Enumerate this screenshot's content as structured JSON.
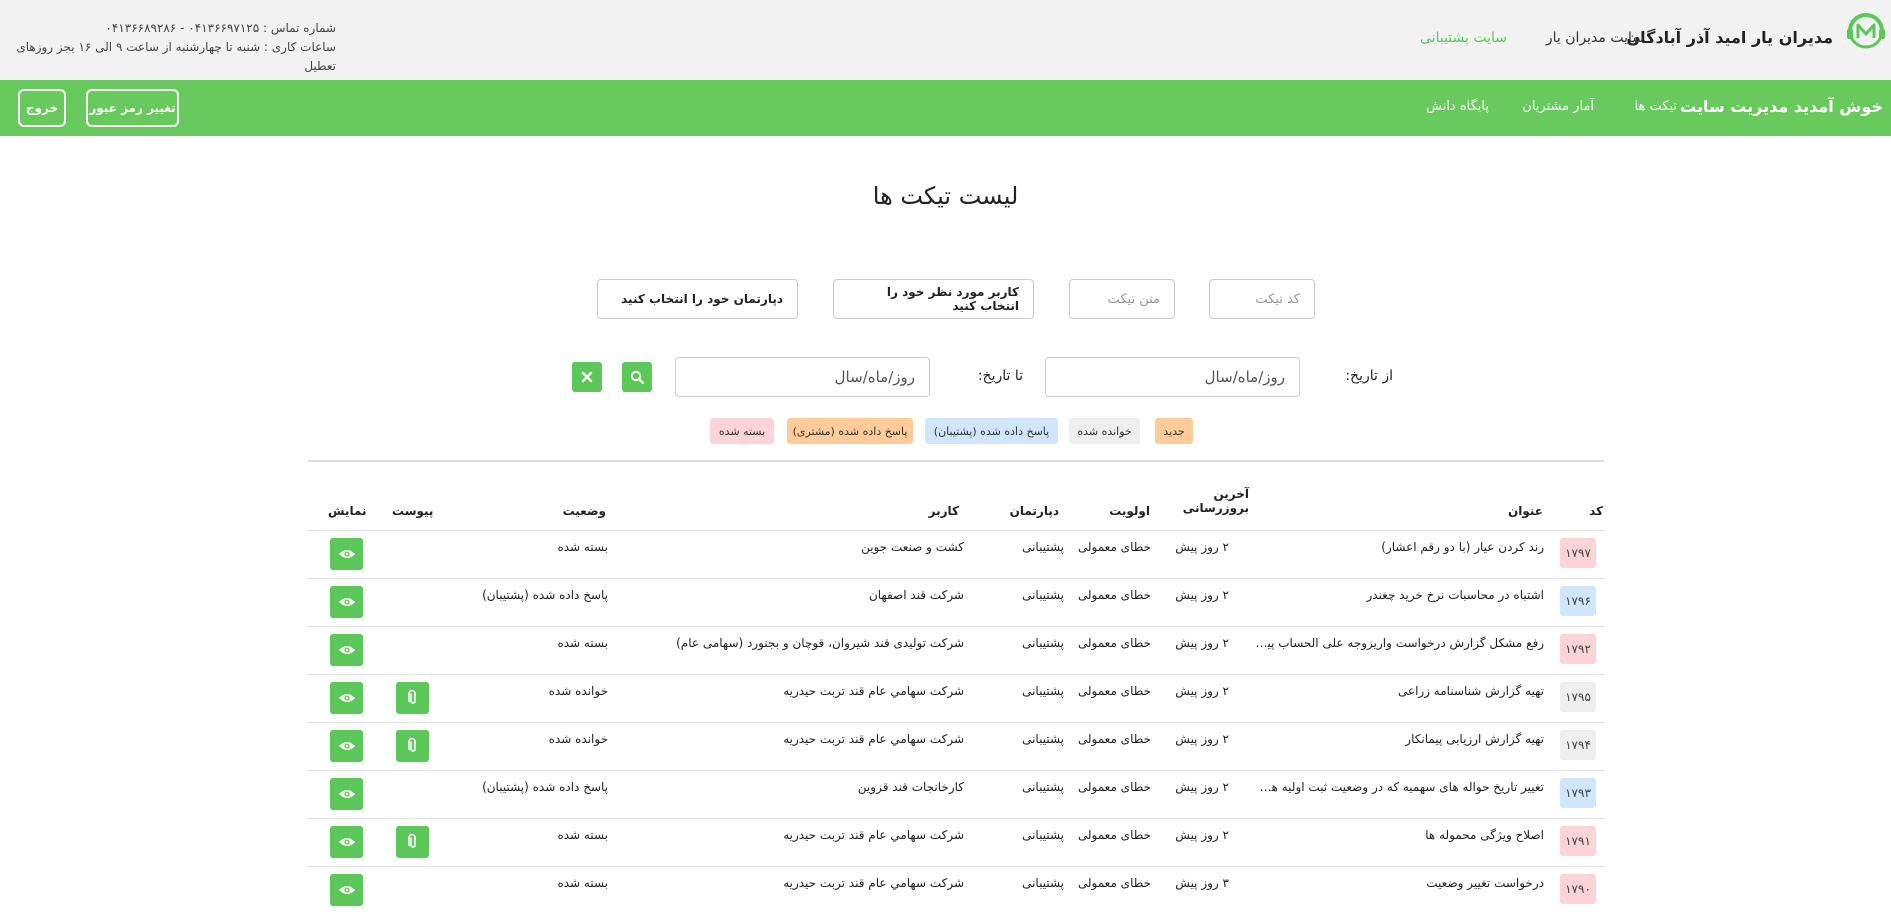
{
  "header": {
    "company": "مدیران یار امید آذر آبادگان",
    "links": {
      "managers_site": "سایت مدیران یار",
      "support_site": "سایت پشتیبانی"
    },
    "contact_phone": "شماره تماس : ۰۴۱۳۶۶۹۷۱۲۵ - ۰۴۱۳۶۶۸۹۲۸۶",
    "work_hours": "ساعات کاری : شنبه تا چهارشنبه از ساعت ۹ الی ۱۶ بجز روزهای تعطیل"
  },
  "nav": {
    "welcome": "خوش آمدید مدیریت سایت",
    "tickets": "تیکت ها",
    "stats": "آمار مشتریان",
    "knowledge": "پایگاه دانش",
    "change_password": "تغییر رمز عبور",
    "logout": "خروج"
  },
  "page_title": "لیست تیکت ها",
  "filters": {
    "code_placeholder": "کد تیکت",
    "text_placeholder": "متن تیکت",
    "user_select": "کاربر مورد نظر خود را انتخاب کنید",
    "dept_select": "دپارتمان خود را انتخاب کنید",
    "from_label": "از تاریخ:",
    "to_label": "تا تاریخ:",
    "date_placeholder": "روز/ماه/سال"
  },
  "legend": {
    "new": "جدید",
    "read": "خوانده شده",
    "answered_support": "پاسخ داده شده (پشتیبان)",
    "answered_customer": "پاسخ داده شده (مشتری)",
    "closed": "بسته شده"
  },
  "colors": {
    "accent_green": "#68c95c",
    "new": "#ffcc99",
    "read": "#eeeeee",
    "answered_support": "#cfe6fb",
    "answered_customer": "#ffcc99",
    "closed": "#fbd3d8"
  },
  "table": {
    "headers": {
      "code": "کد",
      "title": "عنوان",
      "update_line1": "آخرین",
      "update_line2": "بروزرسانی",
      "priority": "اولویت",
      "dept": "دپارتمان",
      "user": "کاربر",
      "status": "وضعیت",
      "attachment": "پیوست",
      "view": "نمایش"
    },
    "rows": [
      {
        "code": "۱۷۹۷",
        "title": "رند کردن عیار (با دو رقم اعشار)",
        "updated": "۲ روز پیش",
        "priority": "خطای معمولی",
        "dept": "پشتیبانی",
        "user": "کشت و صنعت جوین",
        "status": "بسته شده",
        "badge_color": "#fbd3d8",
        "has_attachment": false
      },
      {
        "code": "۱۷۹۶",
        "title": "اشتباه در محاسبات نرخ خرید چغندر",
        "updated": "۲ روز پیش",
        "priority": "خطای معمولی",
        "dept": "پشتیبانی",
        "user": "شرکت قند اصفهان",
        "status": "پاسخ داده شده (پشتیبان)",
        "badge_color": "#cfe6fb",
        "has_attachment": false
      },
      {
        "code": "۱۷۹۲",
        "title": "رفع مشکل گزارش درخواست واریزوجه علی الحساب پیمانکار",
        "updated": "۲ روز پیش",
        "priority": "خطای معمولی",
        "dept": "پشتیبانی",
        "user": "شرکت تولیدی قند شیروان، قوچان و بجنورد (سهامی عام)",
        "status": "بسته شده",
        "badge_color": "#fbd3d8",
        "has_attachment": false
      },
      {
        "code": "۱۷۹۵",
        "title": "تهیه گزارش شناسنامه زراعی",
        "updated": "۲ روز پیش",
        "priority": "خطای معمولی",
        "dept": "پشتیبانی",
        "user": "شركت سهامي عام قند تربت حيدريه",
        "status": "خوانده شده",
        "badge_color": "#eeeeee",
        "has_attachment": true
      },
      {
        "code": "۱۷۹۴",
        "title": "تهیه گزارش ارزیابی پیمانکار",
        "updated": "۲ روز پیش",
        "priority": "خطای معمولی",
        "dept": "پشتیبانی",
        "user": "شركت سهامي عام قند تربت حيدريه",
        "status": "خوانده شده",
        "badge_color": "#eeeeee",
        "has_attachment": true
      },
      {
        "code": "۱۷۹۳",
        "title": "تغییر تاریخ حواله های سهمیه که در وضعیت ثبت اولیه هستند",
        "updated": "۲ روز پیش",
        "priority": "خطای معمولی",
        "dept": "پشتیبانی",
        "user": "کارخانجات قند قزوین",
        "status": "پاسخ داده شده (پشتیبان)",
        "badge_color": "#cfe6fb",
        "has_attachment": false
      },
      {
        "code": "۱۷۹۱",
        "title": "اصلاح ویژگی محموله ها",
        "updated": "۲ روز پیش",
        "priority": "خطای معمولی",
        "dept": "پشتیبانی",
        "user": "شركت سهامي عام قند تربت حيدريه",
        "status": "بسته شده",
        "badge_color": "#fbd3d8",
        "has_attachment": true
      },
      {
        "code": "۱۷۹۰",
        "title": "درخواست تغییر وضعیت",
        "updated": "۳ روز پیش",
        "priority": "خطای معمولی",
        "dept": "پشتیبانی",
        "user": "شركت سهامي عام قند تربت حيدريه",
        "status": "بسته شده",
        "badge_color": "#fbd3d8",
        "has_attachment": false
      }
    ]
  }
}
